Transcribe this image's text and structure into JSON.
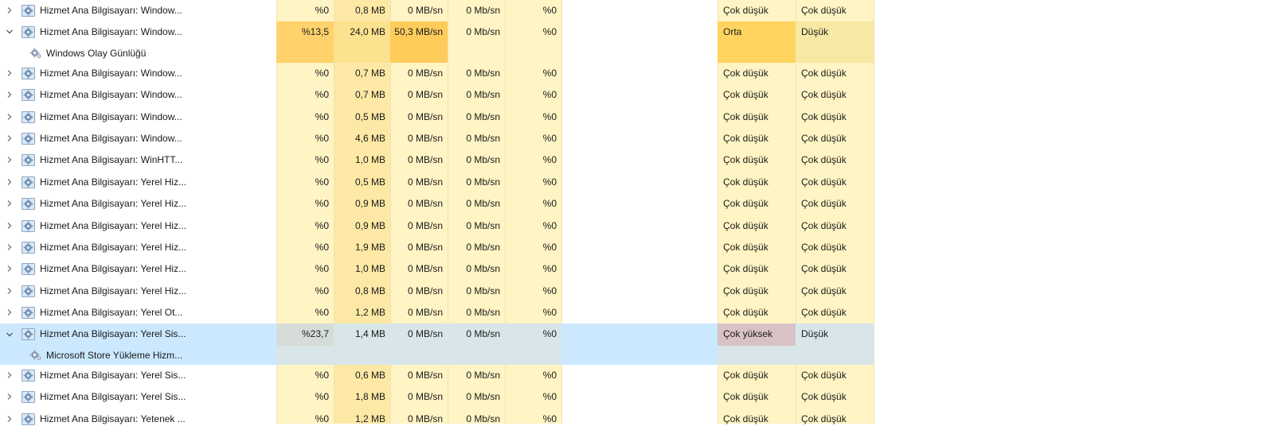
{
  "colors": {
    "row_selected": "#cce8ff",
    "cpu_band": "#fff4c4",
    "mem_band": "#fde9a5",
    "col_band": "#fff4c4",
    "impact_band": "#fff4c4",
    "cpu_highlight": "#ffd26b",
    "disk_highlight": "#ffcc5c",
    "mem_highlight": "#fce28e",
    "impact_orta": "#ffd560",
    "impact_dusuk_hi": "#f7e8a4",
    "impact_cok_yuksek": "#d9c2c6"
  },
  "icons": {
    "expand": "chevron-right-icon",
    "collapse": "chevron-down-icon",
    "service": "gear-service-icon"
  },
  "rows": [
    {
      "type": "parent",
      "expanded": false,
      "name": "Hizmet Ana Bilgisayarı: Window...",
      "cpu": "%0",
      "mem": "0,8 MB",
      "disk": "0 MB/sn",
      "net": "0 Mb/sn",
      "gpu": "%0",
      "power": "Çok düşük",
      "trend": "Çok düşük"
    },
    {
      "type": "parent",
      "expanded": true,
      "name": "Hizmet Ana Bilgisayarı: Window...",
      "cpu": "%13,5",
      "mem": "24,0 MB",
      "disk": "50,3 MB/sn",
      "net": "0 Mb/sn",
      "gpu": "%0",
      "power": "Orta",
      "trend": "Düşük",
      "hl": "hot"
    },
    {
      "type": "child",
      "name": "Windows Olay Günlüğü",
      "hl": "hot"
    },
    {
      "type": "parent",
      "expanded": false,
      "name": "Hizmet Ana Bilgisayarı: Window...",
      "cpu": "%0",
      "mem": "0,7 MB",
      "disk": "0 MB/sn",
      "net": "0 Mb/sn",
      "gpu": "%0",
      "power": "Çok düşük",
      "trend": "Çok düşük"
    },
    {
      "type": "parent",
      "expanded": false,
      "name": "Hizmet Ana Bilgisayarı: Window...",
      "cpu": "%0",
      "mem": "0,7 MB",
      "disk": "0 MB/sn",
      "net": "0 Mb/sn",
      "gpu": "%0",
      "power": "Çok düşük",
      "trend": "Çok düşük"
    },
    {
      "type": "parent",
      "expanded": false,
      "name": "Hizmet Ana Bilgisayarı: Window...",
      "cpu": "%0",
      "mem": "0,5 MB",
      "disk": "0 MB/sn",
      "net": "0 Mb/sn",
      "gpu": "%0",
      "power": "Çok düşük",
      "trend": "Çok düşük"
    },
    {
      "type": "parent",
      "expanded": false,
      "name": "Hizmet Ana Bilgisayarı: Window...",
      "cpu": "%0",
      "mem": "4,6 MB",
      "disk": "0 MB/sn",
      "net": "0 Mb/sn",
      "gpu": "%0",
      "power": "Çok düşük",
      "trend": "Çok düşük"
    },
    {
      "type": "parent",
      "expanded": false,
      "name": "Hizmet Ana Bilgisayarı: WinHTT...",
      "cpu": "%0",
      "mem": "1,0 MB",
      "disk": "0 MB/sn",
      "net": "0 Mb/sn",
      "gpu": "%0",
      "power": "Çok düşük",
      "trend": "Çok düşük"
    },
    {
      "type": "parent",
      "expanded": false,
      "name": "Hizmet Ana Bilgisayarı: Yerel Hiz...",
      "cpu": "%0",
      "mem": "0,5 MB",
      "disk": "0 MB/sn",
      "net": "0 Mb/sn",
      "gpu": "%0",
      "power": "Çok düşük",
      "trend": "Çok düşük"
    },
    {
      "type": "parent",
      "expanded": false,
      "name": "Hizmet Ana Bilgisayarı: Yerel Hiz...",
      "cpu": "%0",
      "mem": "0,9 MB",
      "disk": "0 MB/sn",
      "net": "0 Mb/sn",
      "gpu": "%0",
      "power": "Çok düşük",
      "trend": "Çok düşük"
    },
    {
      "type": "parent",
      "expanded": false,
      "name": "Hizmet Ana Bilgisayarı: Yerel Hiz...",
      "cpu": "%0",
      "mem": "0,9 MB",
      "disk": "0 MB/sn",
      "net": "0 Mb/sn",
      "gpu": "%0",
      "power": "Çok düşük",
      "trend": "Çok düşük"
    },
    {
      "type": "parent",
      "expanded": false,
      "name": "Hizmet Ana Bilgisayarı: Yerel Hiz...",
      "cpu": "%0",
      "mem": "1,9 MB",
      "disk": "0 MB/sn",
      "net": "0 Mb/sn",
      "gpu": "%0",
      "power": "Çok düşük",
      "trend": "Çok düşük"
    },
    {
      "type": "parent",
      "expanded": false,
      "name": "Hizmet Ana Bilgisayarı: Yerel Hiz...",
      "cpu": "%0",
      "mem": "1,0 MB",
      "disk": "0 MB/sn",
      "net": "0 Mb/sn",
      "gpu": "%0",
      "power": "Çok düşük",
      "trend": "Çok düşük"
    },
    {
      "type": "parent",
      "expanded": false,
      "name": "Hizmet Ana Bilgisayarı: Yerel Hiz...",
      "cpu": "%0",
      "mem": "0,8 MB",
      "disk": "0 MB/sn",
      "net": "0 Mb/sn",
      "gpu": "%0",
      "power": "Çok düşük",
      "trend": "Çok düşük"
    },
    {
      "type": "parent",
      "expanded": false,
      "name": "Hizmet Ana Bilgisayarı: Yerel Ot...",
      "cpu": "%0",
      "mem": "1,2 MB",
      "disk": "0 MB/sn",
      "net": "0 Mb/sn",
      "gpu": "%0",
      "power": "Çok düşük",
      "trend": "Çok düşük"
    },
    {
      "type": "parent",
      "expanded": true,
      "name": "Hizmet Ana Bilgisayarı: Yerel Sis...",
      "cpu": "%23,7",
      "mem": "1,4 MB",
      "disk": "0 MB/sn",
      "net": "0 Mb/sn",
      "gpu": "%0",
      "power": "Çok yüksek",
      "trend": "Düşük",
      "selected": true
    },
    {
      "type": "child",
      "name": "Microsoft Store Yükleme Hizm...",
      "selected": true
    },
    {
      "type": "parent",
      "expanded": false,
      "name": "Hizmet Ana Bilgisayarı: Yerel Sis...",
      "cpu": "%0",
      "mem": "0,6 MB",
      "disk": "0 MB/sn",
      "net": "0 Mb/sn",
      "gpu": "%0",
      "power": "Çok düşük",
      "trend": "Çok düşük"
    },
    {
      "type": "parent",
      "expanded": false,
      "name": "Hizmet Ana Bilgisayarı: Yerel Sis...",
      "cpu": "%0",
      "mem": "1,8 MB",
      "disk": "0 MB/sn",
      "net": "0 Mb/sn",
      "gpu": "%0",
      "power": "Çok düşük",
      "trend": "Çok düşük"
    },
    {
      "type": "parent",
      "expanded": false,
      "name": "Hizmet Ana Bilgisayarı: Yetenek ...",
      "cpu": "%0",
      "mem": "1,2 MB",
      "disk": "0 MB/sn",
      "net": "0 Mb/sn",
      "gpu": "%0",
      "power": "Çok düşük",
      "trend": "Çok düşük"
    }
  ]
}
